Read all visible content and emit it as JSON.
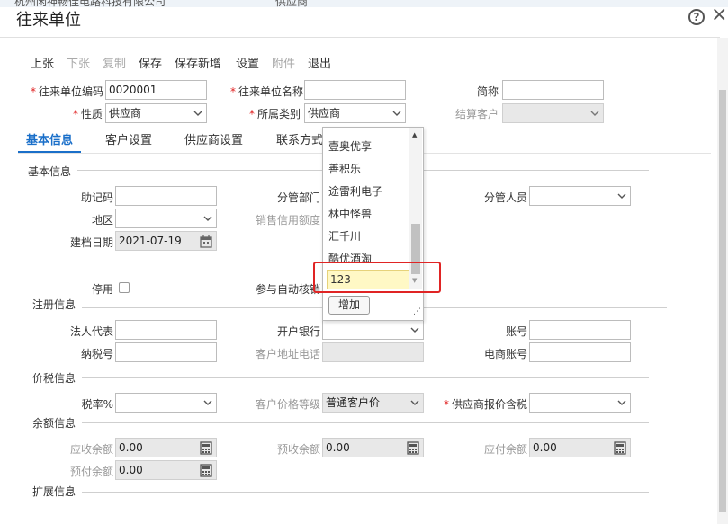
{
  "background_strip": {
    "left_text": "杭州闲神畅佳电路科技有限公司",
    "mid_text": "供应商"
  },
  "window": {
    "title": "往来单位",
    "help_glyph": "?",
    "close_glyph": "×"
  },
  "toolbar": {
    "prev": "上张",
    "next": "下张",
    "copy": "复制",
    "save": "保存",
    "save_new": "保存新增",
    "settings": "设置",
    "attachment": "附件",
    "exit": "退出"
  },
  "header_form": {
    "code_label": "往来单位编码",
    "code_value": "0020001",
    "name_label": "往来单位名称",
    "name_value": "",
    "abbr_label": "简称",
    "abbr_value": "",
    "nature_label": "性质",
    "nature_value": "供应商",
    "category_label": "所属类别",
    "category_value": "供应商",
    "settle_label": "结算客户",
    "settle_value": ""
  },
  "tabs": [
    "基本信息",
    "客户设置",
    "供应商设置",
    "联系方式"
  ],
  "basic": {
    "section": "基本信息",
    "mnemonic_label": "助记码",
    "dept_label": "分管部门",
    "staff_label": "分管人员",
    "region_label": "地区",
    "credit_label": "销售信用额度",
    "created_label": "建档日期",
    "created_value": "2021-07-19",
    "disabled_label": "停用",
    "auto_verify_label": "参与自动核销"
  },
  "register": {
    "section": "注册信息",
    "legal_label": "法人代表",
    "bank_label": "开户银行",
    "account_label": "账号",
    "tax_no_label": "纳税号",
    "address_label": "客户地址电话",
    "ecom_label": "电商账号"
  },
  "tax": {
    "section": "价税信息",
    "rate_label": "税率%",
    "price_level_label": "客户价格等级",
    "price_level_value": "普通客户价",
    "supplier_tax_label": "供应商报价含税"
  },
  "balance": {
    "section": "余额信息",
    "receivable_label": "应收余额",
    "receivable_value": "0.00",
    "advance_recv_label": "预收余额",
    "advance_recv_value": "0.00",
    "payable_label": "应付余额",
    "payable_value": "0.00",
    "prepaid_label": "预付余额",
    "prepaid_value": "0.00"
  },
  "extend": {
    "section": "扩展信息"
  },
  "dropdown": {
    "items": [
      "壹奥优享",
      "善积乐",
      "途雷利电子",
      "林中怪兽",
      "汇千川",
      "酷优酒淘"
    ],
    "input_value": "123",
    "add_button": "增加",
    "up_glyph": "▲",
    "down_glyph": "▼",
    "resize_glyph": "⋰"
  },
  "colors": {
    "accent": "#1a6fc9",
    "highlight": "#e02424",
    "input_highlight": "#fff8c5"
  }
}
